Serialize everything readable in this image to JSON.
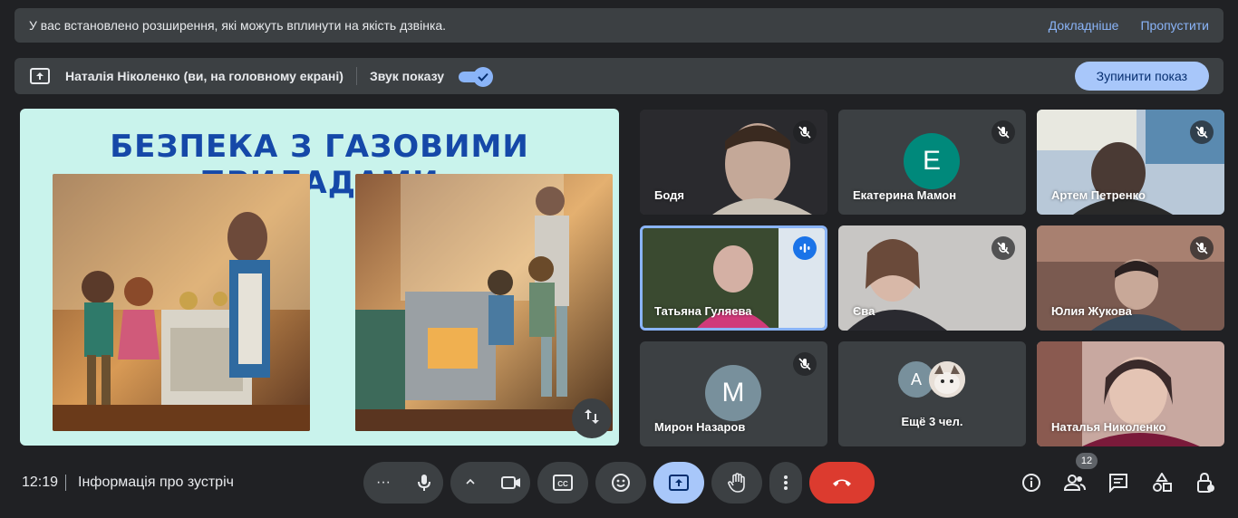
{
  "banner": {
    "text": "У вас встановлено розширення, які можуть вплинути на якість дзвінка.",
    "details_link": "Докладніше",
    "skip_link": "Пропустити"
  },
  "share_bar": {
    "presenter": "Наталія Ніколенко (ви, на головному екрані)",
    "sound_label": "Звук показу",
    "sound_on": true,
    "stop_button": "Зупинити показ"
  },
  "presentation": {
    "slide_title": "БЕЗПЕКА З ГАЗОВИМИ ПРИЛАДАМИ"
  },
  "participants": [
    {
      "name": "Бодя",
      "muted": true
    },
    {
      "name": "Екатерина Мамон",
      "muted": true,
      "initial": "E",
      "avatar_color": "#00897b"
    },
    {
      "name": "Артем Петренко",
      "muted": true
    },
    {
      "name": "Татьяна Гуляева",
      "muted": false,
      "speaking": true
    },
    {
      "name": "Єва",
      "muted": true
    },
    {
      "name": "Юлия Жукова",
      "muted": true
    },
    {
      "name": "Мирон Назаров",
      "muted": true,
      "initial": "M",
      "avatar_color": "#78909c"
    },
    {
      "name": "Ещё 3 чел.",
      "initial": "A"
    },
    {
      "name": "Наталья Николенко"
    }
  ],
  "footer": {
    "time": "12:19",
    "meeting_info": "Інформація про зустріч",
    "participant_count": "12"
  },
  "colors": {
    "accent": "#8ab4f8",
    "end_call": "#ea4335",
    "active_present": "#a8c7fa"
  }
}
